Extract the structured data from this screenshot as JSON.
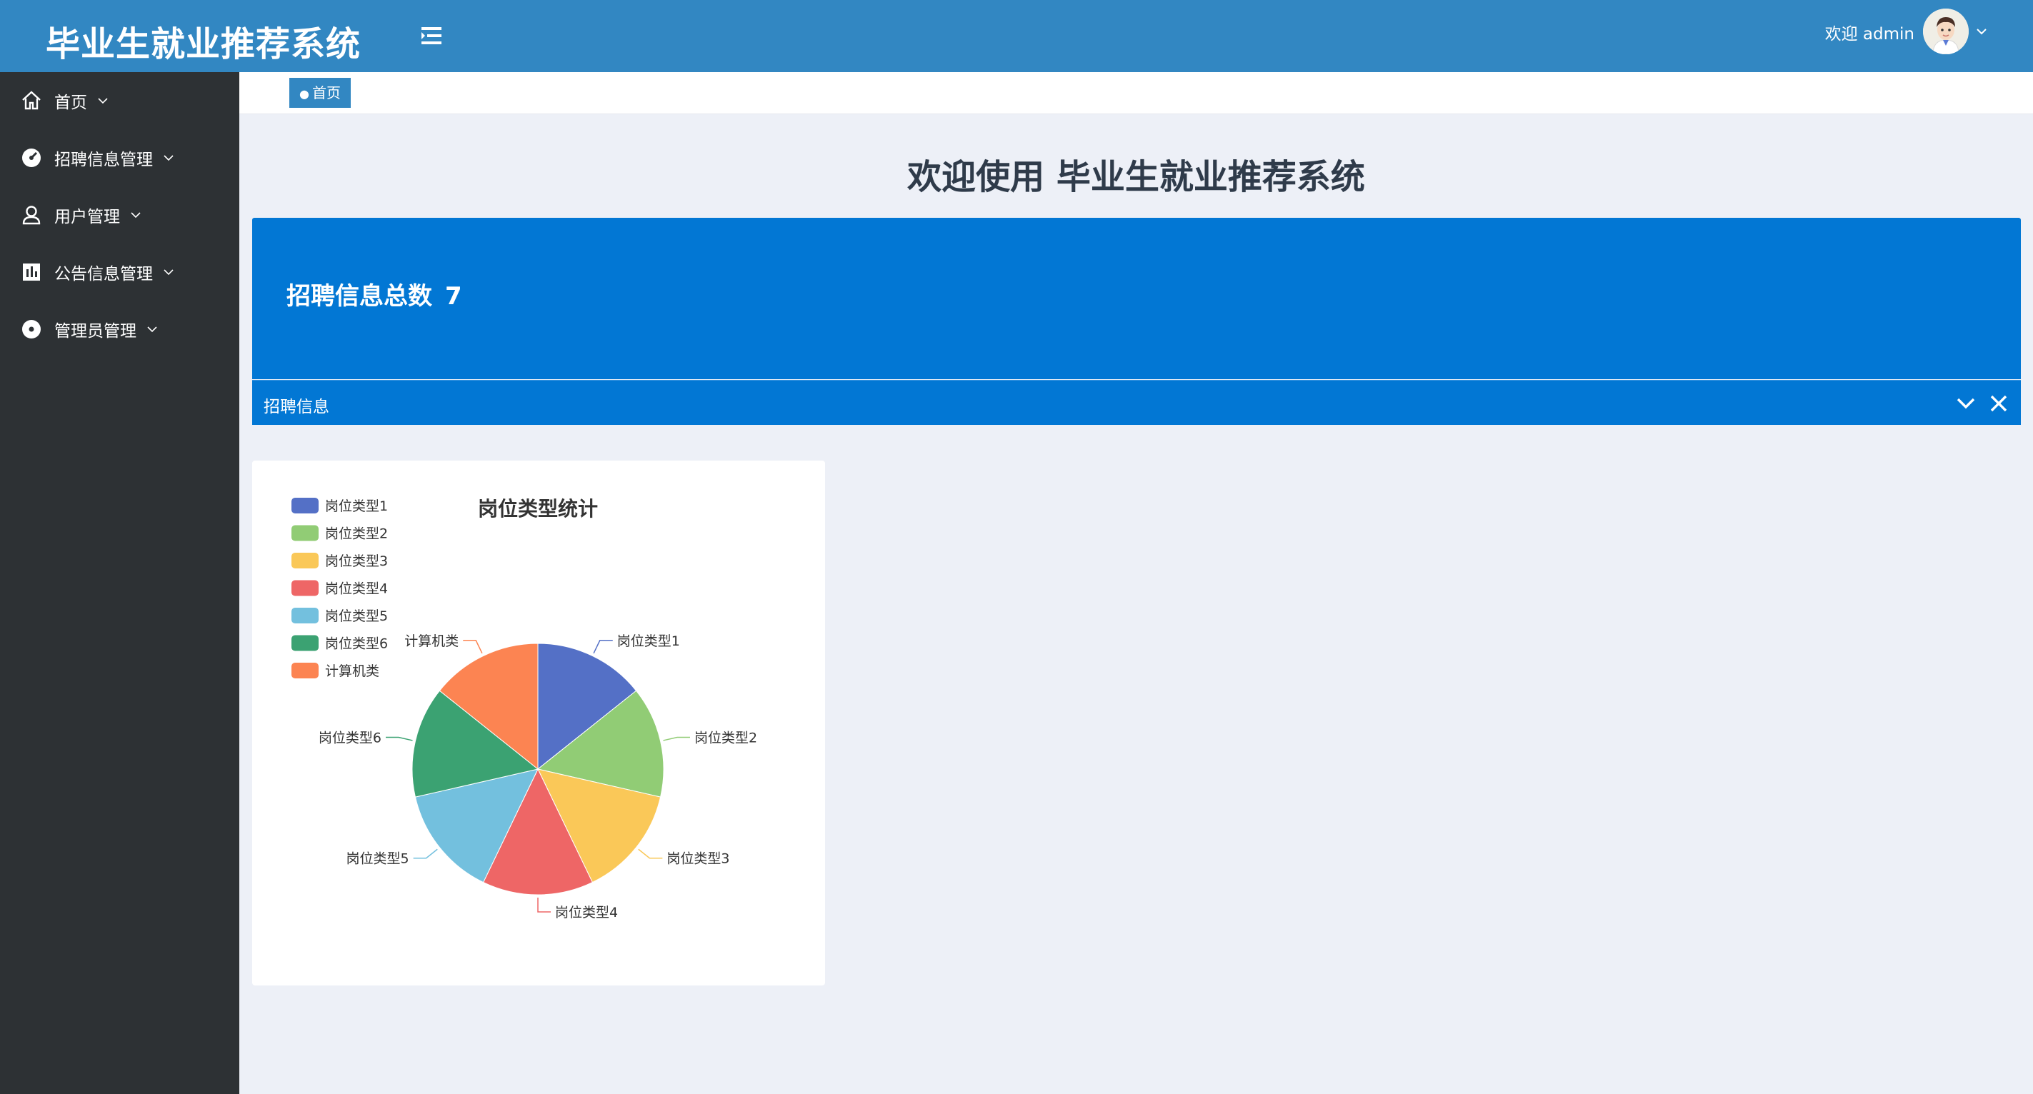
{
  "app": {
    "title": "毕业生就业推荐系统",
    "welcome": "欢迎 admin"
  },
  "sidebar": {
    "items": [
      {
        "label": "首页",
        "icon": "home-icon"
      },
      {
        "label": "招聘信息管理",
        "icon": "gauge-icon"
      },
      {
        "label": "用户管理",
        "icon": "user-icon"
      },
      {
        "label": "公告信息管理",
        "icon": "bar-chart-icon"
      },
      {
        "label": "管理员管理",
        "icon": "record-icon"
      }
    ]
  },
  "breadcrumb": {
    "current": "首页"
  },
  "main": {
    "title": "欢迎使用 毕业生就业推荐系统",
    "stat_label": "招聘信息总数",
    "stat_value": "7",
    "stat_footer": "招聘信息"
  },
  "chart_data": {
    "type": "pie",
    "title": "岗位类型统计",
    "categories": [
      "岗位类型1",
      "岗位类型2",
      "岗位类型3",
      "岗位类型4",
      "岗位类型5",
      "岗位类型6",
      "计算机类"
    ],
    "values": [
      1,
      1,
      1,
      1,
      1,
      1,
      1
    ],
    "colors": [
      "#5470c6",
      "#91cc75",
      "#fac858",
      "#ee6666",
      "#73c0de",
      "#3ba272",
      "#fc8452"
    ],
    "legend_position": "top-left"
  },
  "colors": {
    "topbar": "#3287c2",
    "sidebar": "#2d3134",
    "stat_card": "#0277d4",
    "background": "#edf0f7"
  }
}
